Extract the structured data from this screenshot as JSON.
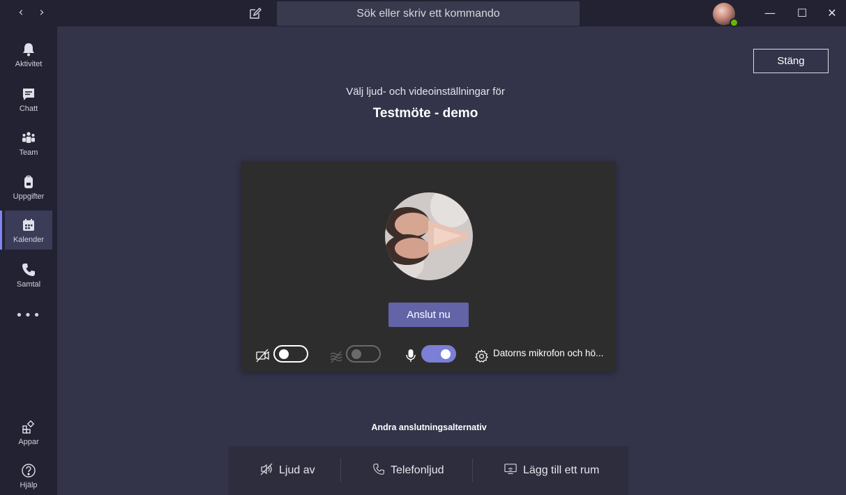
{
  "titlebar": {
    "back_icon": "chevron-left-icon",
    "forward_icon": "chevron-right-icon",
    "compose_icon": "compose-icon",
    "search_placeholder": "Sök eller skriv ett kommando",
    "window_controls": {
      "minimize": "—",
      "maximize": "☐",
      "close": "✕"
    }
  },
  "rail": {
    "items": [
      {
        "id": "activity",
        "label": "Aktivitet",
        "icon": "bell-icon"
      },
      {
        "id": "chat",
        "label": "Chatt",
        "icon": "chat-icon"
      },
      {
        "id": "teams",
        "label": "Team",
        "icon": "teams-icon"
      },
      {
        "id": "assignments",
        "label": "Uppgifter",
        "icon": "backpack-icon"
      },
      {
        "id": "calendar",
        "label": "Kalender",
        "icon": "calendar-icon",
        "active": true
      },
      {
        "id": "calls",
        "label": "Samtal",
        "icon": "phone-icon"
      }
    ],
    "more": "•••",
    "bottom": [
      {
        "id": "apps",
        "label": "Appar",
        "icon": "apps-icon"
      },
      {
        "id": "help",
        "label": "Hjälp",
        "icon": "help-icon"
      }
    ]
  },
  "main": {
    "close_label": "Stäng",
    "subtitle": "Välj ljud- och videoinställningar för",
    "meeting_title": "Testmöte - demo",
    "join_label": "Anslut nu",
    "controls": {
      "video": {
        "icon": "video-off-icon",
        "state": "off"
      },
      "blur": {
        "icon": "background-blur-icon",
        "state": "disabled"
      },
      "mic": {
        "icon": "microphone-icon",
        "state": "on"
      },
      "device_label": "Datorns mikrofon och hö...",
      "device_icon": "gear-icon"
    },
    "other_title": "Andra anslutningsalternativ",
    "other_options": [
      {
        "label": "Ljud av",
        "icon": "speaker-off-icon"
      },
      {
        "label": "Telefonljud",
        "icon": "phone-icon"
      },
      {
        "label": "Lägg till ett rum",
        "icon": "room-cast-icon"
      }
    ]
  },
  "colors": {
    "background": "#33344a",
    "rail": "#222232",
    "accent": "#6264a7",
    "toggle_on": "#7b7fd6",
    "presence": "#6bb700"
  }
}
